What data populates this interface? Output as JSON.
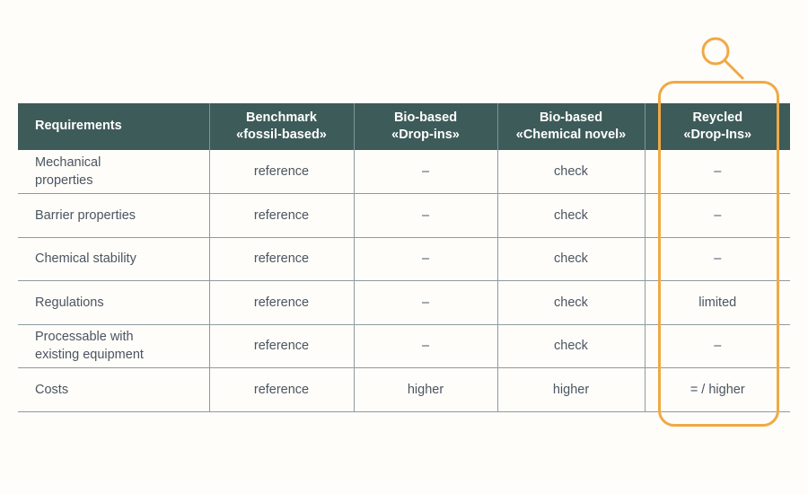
{
  "table": {
    "headers": [
      {
        "line1": "Requirements",
        "line2": ""
      },
      {
        "line1": "Benchmark",
        "line2": "«fossil-based»"
      },
      {
        "line1": "Bio-based",
        "line2": "«Drop-ins»"
      },
      {
        "line1": "Bio-based",
        "line2": "«Chemical novel»"
      },
      {
        "line1": "Reycled",
        "line2": "«Drop-Ins»"
      }
    ],
    "rows": [
      {
        "requirement_line1": "Mechanical",
        "requirement_line2": "properties",
        "benchmark": "reference",
        "bio_dropins": "–",
        "bio_chemical_novel": "check",
        "recycled_dropins": "–"
      },
      {
        "requirement_line1": "Barrier properties",
        "requirement_line2": "",
        "benchmark": "reference",
        "bio_dropins": "–",
        "bio_chemical_novel": "check",
        "recycled_dropins": "–"
      },
      {
        "requirement_line1": "Chemical stability",
        "requirement_line2": "",
        "benchmark": "reference",
        "bio_dropins": "–",
        "bio_chemical_novel": "check",
        "recycled_dropins": "–"
      },
      {
        "requirement_line1": "Regulations",
        "requirement_line2": "",
        "benchmark": "reference",
        "bio_dropins": "–",
        "bio_chemical_novel": "check",
        "recycled_dropins": "limited"
      },
      {
        "requirement_line1": "Processable with",
        "requirement_line2": "existing equipment",
        "benchmark": "reference",
        "bio_dropins": "–",
        "bio_chemical_novel": "check",
        "recycled_dropins": "–"
      },
      {
        "requirement_line1": "Costs",
        "requirement_line2": "",
        "benchmark": "reference",
        "bio_dropins": "higher",
        "bio_chemical_novel": "higher",
        "recycled_dropins": "= / higher"
      }
    ]
  },
  "annotation": {
    "highlight_column": "Reycled «Drop-Ins»",
    "icon": "magnifier-icon"
  },
  "colors": {
    "header_background": "#3d5b59",
    "header_text": "#ffffff",
    "body_text": "#4a5560",
    "grid_line": "#8d9aa1",
    "highlight_accent": "#f0a945",
    "page_background": "#fffdfa"
  }
}
